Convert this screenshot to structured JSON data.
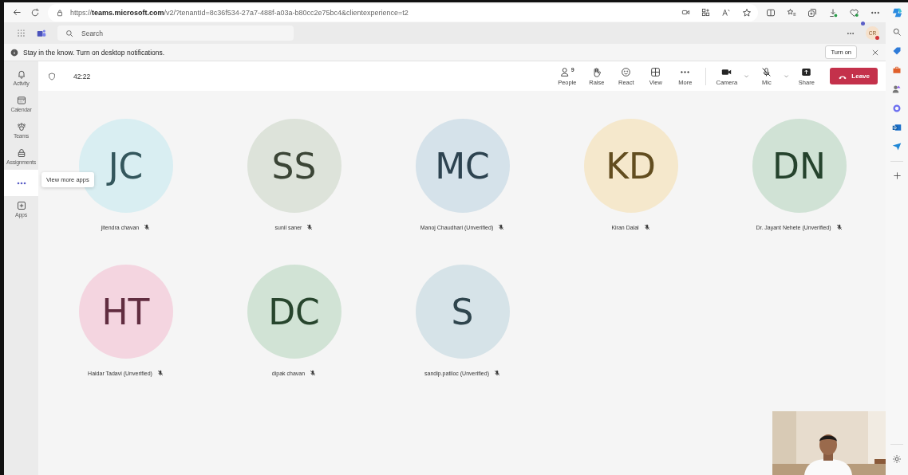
{
  "browser": {
    "url": "https://**teams.microsoft.com**/v2/?tenantId=8c36f534-27a7-488f-a03a-b80cc2e75bc4&clientexperience=t2"
  },
  "header": {
    "search": {
      "placeholder": "Search"
    },
    "avatar": {
      "initials": "CR"
    }
  },
  "notification": {
    "text": "Stay in the know. Turn on desktop notifications.",
    "button": "Turn on"
  },
  "rail": {
    "items": [
      {
        "kind": "activity",
        "label": "Activity",
        "selected": false
      },
      {
        "kind": "calendar",
        "label": "Calendar",
        "selected": false
      },
      {
        "kind": "teams",
        "label": "Teams",
        "selected": false
      },
      {
        "kind": "assignments",
        "label": "Assignments",
        "selected": false
      },
      {
        "kind": "more",
        "selected": true
      },
      {
        "kind": "apps",
        "label": "Apps",
        "selected": false
      }
    ],
    "tooltip": "View more apps"
  },
  "meeting": {
    "timer": "42:22",
    "controls": [
      {
        "kind": "people",
        "label": "People",
        "count": "9"
      },
      {
        "kind": "raise",
        "label": "Raise"
      },
      {
        "kind": "react",
        "label": "React"
      },
      {
        "kind": "view",
        "label": "View"
      },
      {
        "kind": "more",
        "label": "More"
      },
      {
        "kind": "camera",
        "label": "Camera"
      },
      {
        "kind": "mic",
        "label": "Mic"
      },
      {
        "kind": "share",
        "label": "Share"
      }
    ],
    "leave": "Leave"
  },
  "participants": [
    {
      "initials": "JC",
      "name": "jitendra chavan",
      "color": "#d9eef2",
      "muted": true
    },
    {
      "initials": "SS",
      "name": "sunil saner",
      "color": "#dde3da",
      "muted": true
    },
    {
      "initials": "MC",
      "name": "Manoj Chaudhari (Unverified)",
      "color": "#d5e2ea",
      "muted": true
    },
    {
      "initials": "KD",
      "name": "Kiran Dalal",
      "color": "#f5e8cc",
      "muted": true
    },
    {
      "initials": "DN",
      "name": "Dr. Jayant Nehete (Unverified)",
      "color": "#d0e2d5",
      "muted": true
    },
    {
      "initials": "HT",
      "name": "Haidar Tadavi (Unverified)",
      "color": "#f4d5e0",
      "muted": true
    },
    {
      "initials": "DC",
      "name": "dipak chavan",
      "color": "#d1e3d5",
      "muted": true
    },
    {
      "initials": "S",
      "name": "sandip.patiloc (Unverified)",
      "color": "#d6e3e8",
      "muted": true
    }
  ]
}
